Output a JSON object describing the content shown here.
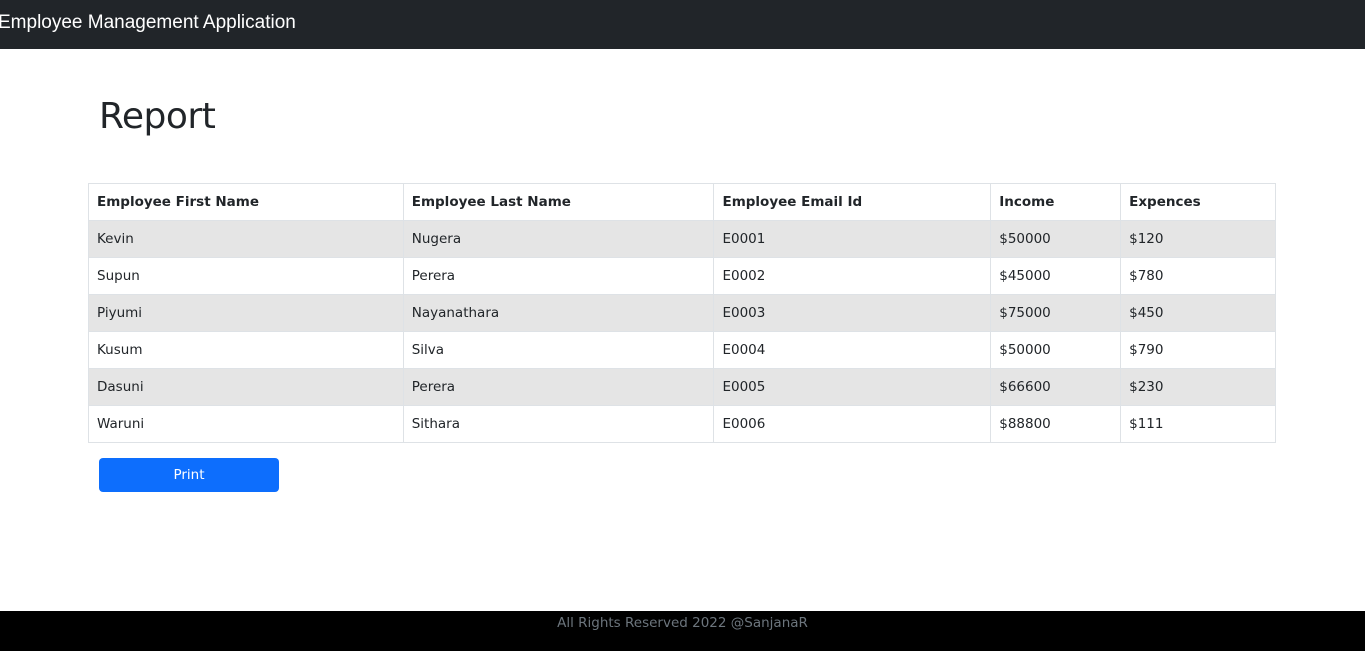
{
  "navbar": {
    "brand": "Employee Management Application"
  },
  "page": {
    "title": "Report"
  },
  "table": {
    "headers": [
      "Employee First Name",
      "Employee Last Name",
      "Employee Email Id",
      "Income",
      "Expences"
    ],
    "rows": [
      [
        "Kevin",
        "Nugera",
        "E0001",
        "$50000",
        "$120"
      ],
      [
        "Supun",
        "Perera",
        "E0002",
        "$45000",
        "$780"
      ],
      [
        "Piyumi",
        "Nayanathara",
        "E0003",
        "$75000",
        "$450"
      ],
      [
        "Kusum",
        "Silva",
        "E0004",
        "$50000",
        "$790"
      ],
      [
        "Dasuni",
        "Perera",
        "E0005",
        "$66600",
        "$230"
      ],
      [
        "Waruni",
        "Sithara",
        "E0006",
        "$88800",
        "$111"
      ]
    ]
  },
  "actions": {
    "print_label": "Print"
  },
  "footer": {
    "text": "All Rights Reserved 2022 @SanjanaR"
  },
  "colors": {
    "navbar": "#212529",
    "primary": "#0d6efd",
    "footer": "#000000",
    "stripe": "#e5e5e5"
  }
}
